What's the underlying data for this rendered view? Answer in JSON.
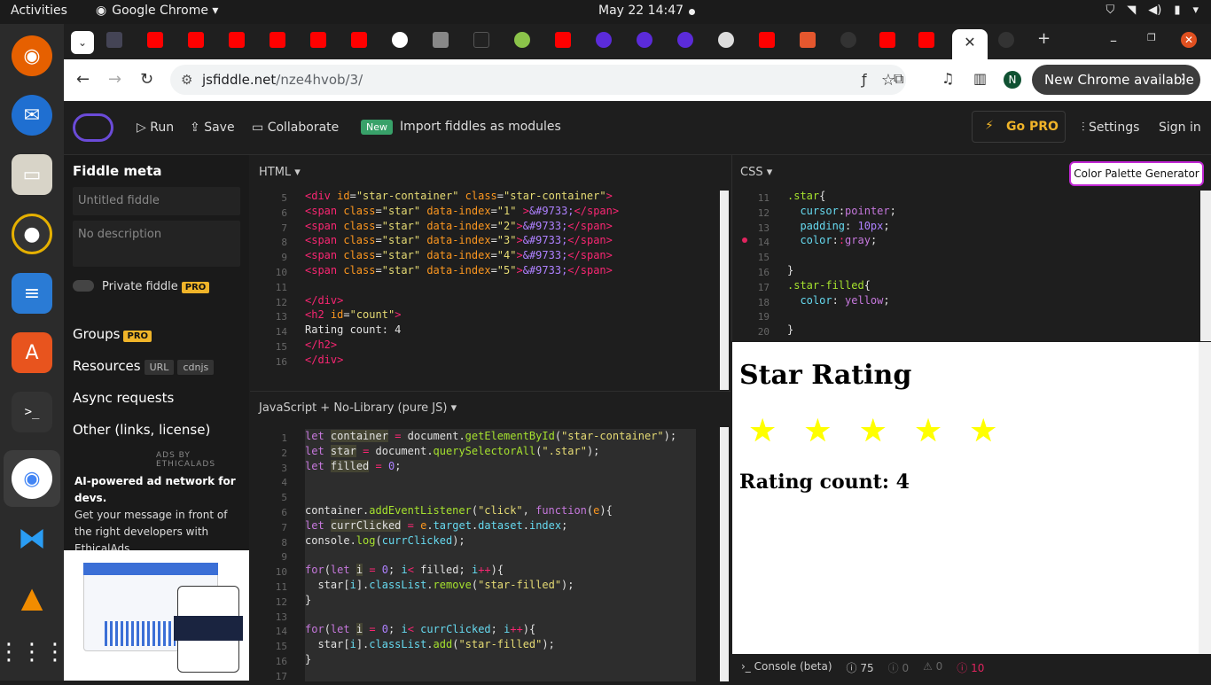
{
  "topbar": {
    "activities": "Activities",
    "app": "Google Chrome ▾",
    "clock": "May 22  14:47"
  },
  "browser": {
    "url_host": "jsfiddle.net",
    "url_path": "/nze4hvob/3/",
    "new_chrome": "New Chrome available",
    "profile": "N"
  },
  "jsfiddle": {
    "run": "Run",
    "save": "Save",
    "collaborate": "Collaborate",
    "new_badge": "New",
    "import": "Import fiddles as modules",
    "gopro": "Go PRO",
    "settings": "Settings",
    "signin": "Sign in"
  },
  "sidebar": {
    "meta_title": "Fiddle meta",
    "title_placeholder": "Untitled fiddle",
    "desc_placeholder": "No description",
    "private": "Private fiddle",
    "pro": "PRO",
    "groups": "Groups",
    "resources": "Resources",
    "url": "URL",
    "cdnjs": "cdnjs",
    "async": "Async requests",
    "other": "Other (links, license)",
    "ads_label": "ADS BY ETHICALADS",
    "ad_title": "AI-powered ad network for devs.",
    "ad_text": "Get your message in front of the right developers with EthicalAds."
  },
  "panels": {
    "html": "HTML ▾",
    "css": "CSS ▾",
    "js": "JavaScript + No-Library (pure JS) ▾",
    "cpg": "Color Palette Generator"
  },
  "result": {
    "title": "Star Rating",
    "stars": [
      "★",
      "★",
      "★",
      "★",
      "★"
    ],
    "count": "Rating count: 4"
  },
  "console": {
    "label": "Console (beta)",
    "info": "75",
    "warn1": "0",
    "warn2": "0",
    "err": "10"
  }
}
